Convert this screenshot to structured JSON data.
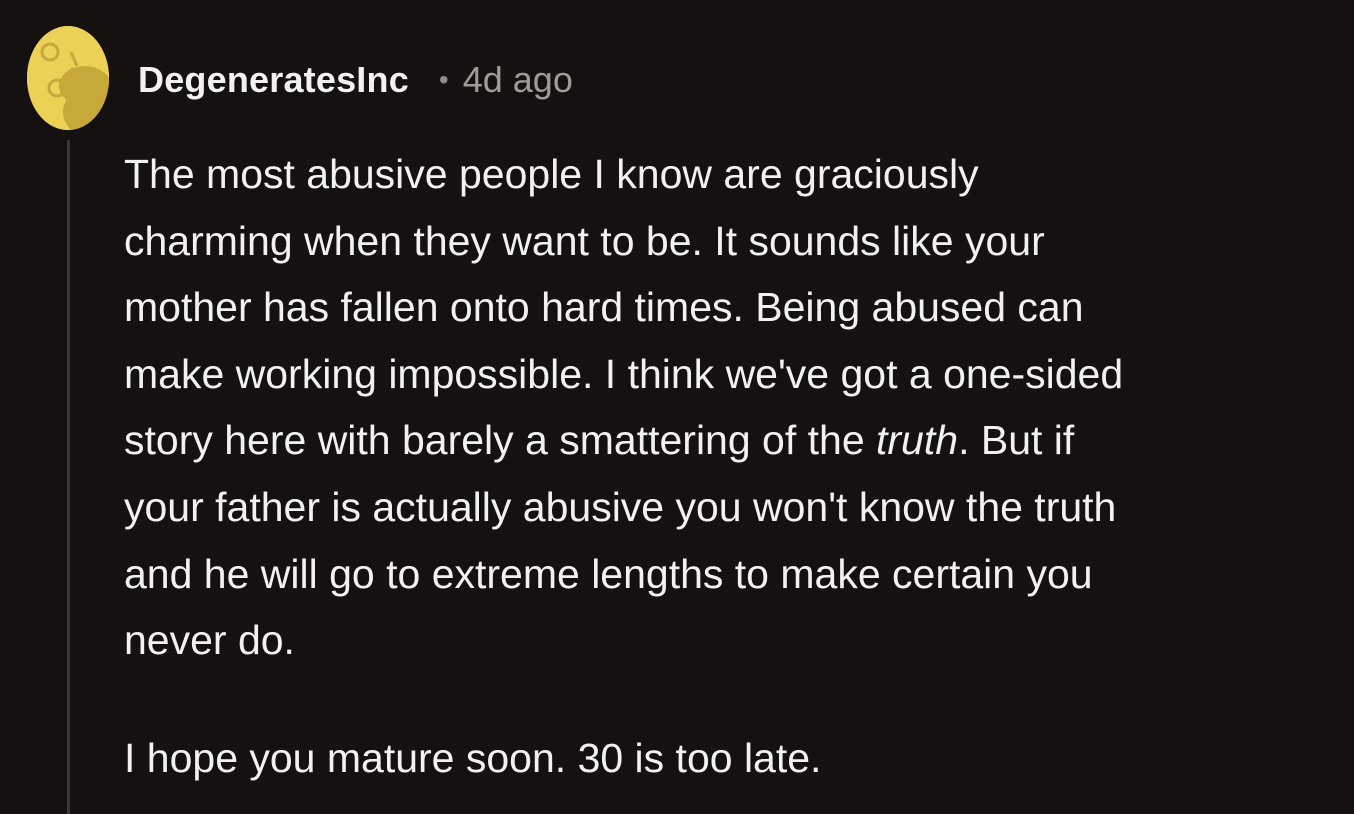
{
  "comment": {
    "username": "DegeneratesInc",
    "separator": "•",
    "timestamp": "4d ago",
    "avatar_icon": "snoo-avatar-icon",
    "colors": {
      "background": "#141110",
      "text": "#f3f1ef",
      "muted": "#a09b95",
      "avatar": "#ebd257",
      "thread_line": "#3b3632"
    },
    "paragraphs": [
      {
        "lines": [
          {
            "text": "The most abusive people I know are graciously"
          },
          {
            "text": "charming when they want to be. It sounds like your"
          },
          {
            "text": "mother has fallen onto hard times. Being abused can"
          },
          {
            "text": "make working impossible. I think we've got a one-sided"
          },
          {
            "before": "story here with barely a smattering of the ",
            "italic": "truth",
            "after": ". But if"
          },
          {
            "text": "your father is actually abusive you won't know the truth"
          },
          {
            "text": "and he will go to extreme lengths to make certain you"
          },
          {
            "text": "never do."
          }
        ]
      },
      {
        "lines": [
          {
            "text": "I hope you mature soon. 30 is too late."
          }
        ]
      }
    ]
  }
}
